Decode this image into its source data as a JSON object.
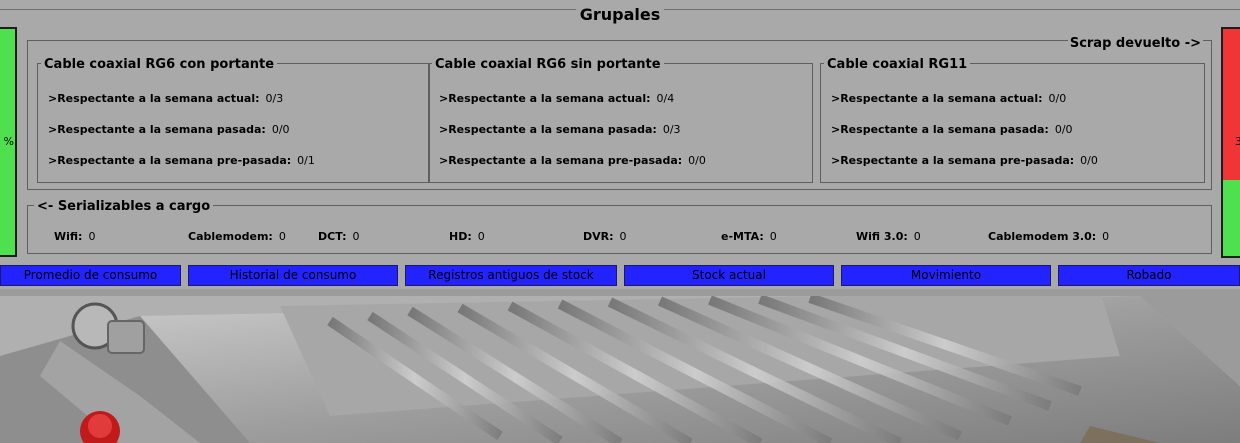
{
  "group": {
    "title": "Grupales"
  },
  "left_status": {
    "text": "%",
    "color": "#4fe04f"
  },
  "right_status": {
    "text": "3",
    "top_color": "#ef3535",
    "bottom_color": "#4fe04f"
  },
  "scrap": {
    "title": "Scrap devuelto ->",
    "cables": [
      {
        "title": "Cable coaxial RG6 con portante",
        "rows": [
          {
            "label": ">Respectante a la semana actual:",
            "value": "0/3"
          },
          {
            "label": ">Respectante a la semana pasada:",
            "value": "0/0"
          },
          {
            "label": ">Respectante a la semana pre-pasada:",
            "value": "0/1"
          }
        ]
      },
      {
        "title": "Cable coaxial RG6 sin portante",
        "rows": [
          {
            "label": ">Respectante a la semana actual:",
            "value": "0/4"
          },
          {
            "label": ">Respectante a la semana pasada:",
            "value": "0/3"
          },
          {
            "label": ">Respectante a la semana pre-pasada:",
            "value": "0/0"
          }
        ]
      },
      {
        "title": "Cable coaxial RG11",
        "rows": [
          {
            "label": ">Respectante a la semana actual:",
            "value": "0/0"
          },
          {
            "label": ">Respectante a la semana pasada:",
            "value": "0/0"
          },
          {
            "label": ">Respectante a la semana pre-pasada:",
            "value": "0/0"
          }
        ]
      }
    ]
  },
  "serializables": {
    "title": "<- Serializables a cargo",
    "items": [
      {
        "label": "Wifi:",
        "value": "0"
      },
      {
        "label": "Cablemodem:",
        "value": "0"
      },
      {
        "label": "DCT:",
        "value": "0"
      },
      {
        "label": "HD:",
        "value": "0"
      },
      {
        "label": "DVR:",
        "value": "0"
      },
      {
        "label": "e-MTA:",
        "value": "0"
      },
      {
        "label": "Wifi 3.0:",
        "value": "0"
      },
      {
        "label": "Cablemodem 3.0:",
        "value": "0"
      }
    ]
  },
  "tabs": [
    "Promedio de consumo",
    "Historial de consumo",
    "Registros antiguos de stock",
    "Stock actual",
    "Movimiento",
    "Robado"
  ],
  "colors": {
    "background": "#a9a9a9",
    "tab": "#2323ff"
  }
}
